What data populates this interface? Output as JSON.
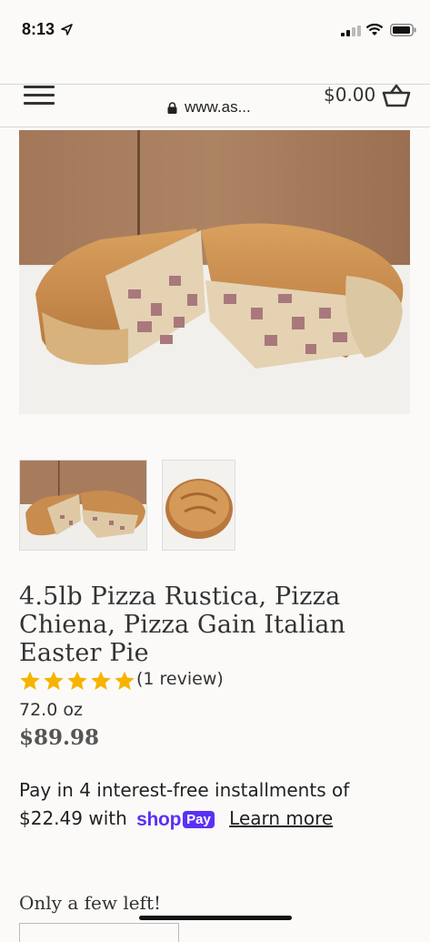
{
  "status_bar": {
    "time": "8:13"
  },
  "browser": {
    "url": "www.as..."
  },
  "header": {
    "cart_total": "$0.00"
  },
  "product": {
    "title": "4.5lb Pizza Rustica, Pizza Chiena, Pizza Gain Italian Easter Pie",
    "rating": 5,
    "rating_max": 5,
    "review_count": "(1 review)",
    "weight": "72.0 oz",
    "price": "$89.98",
    "image_count": 2
  },
  "payment": {
    "prefix": "Pay in 4 interest-free installments of",
    "amount": "$22.49",
    "with": "with",
    "shop_word": "shop",
    "pay_badge": "Pay",
    "learn_more": "Learn more"
  },
  "stock_message": "Only a few left!",
  "colors": {
    "star": "#f5b400",
    "shop_pay": "#5a31f4",
    "text": "#333333"
  },
  "icons": [
    "location-arrow-icon",
    "signal-icon",
    "wifi-icon",
    "battery-icon",
    "lock-icon",
    "menu-icon",
    "cart-icon",
    "star-icon"
  ]
}
